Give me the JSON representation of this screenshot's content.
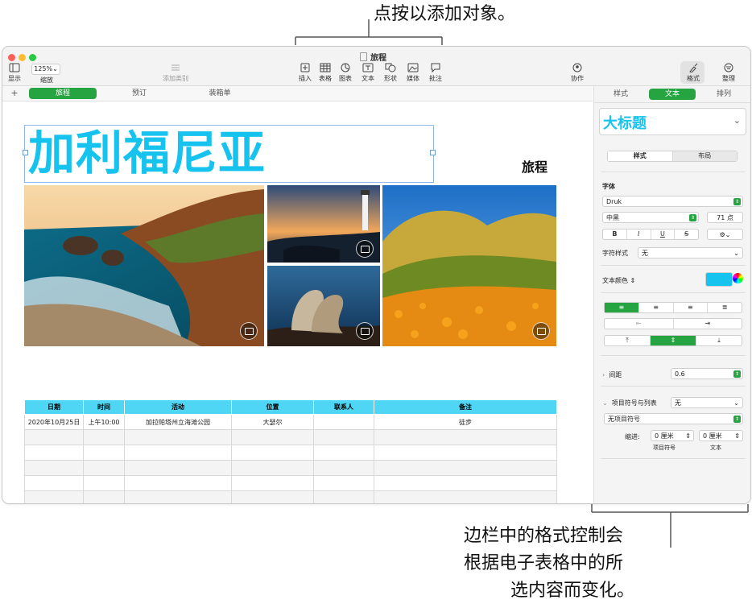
{
  "callouts": {
    "top": "点按以添加对象。",
    "bottom_line1": "边栏中的格式控制会",
    "bottom_line2": "根据电子表格中的所",
    "bottom_line3": "选内容而变化。"
  },
  "window": {
    "title": "旅程"
  },
  "toolbar": {
    "view_label": "显示",
    "zoom_value": "125%",
    "zoom_label": "缩放",
    "add_category_label": "添加类别",
    "insert_label": "插入",
    "table_label": "表格",
    "chart_label": "图表",
    "text_label": "文本",
    "shape_label": "形状",
    "media_label": "媒体",
    "comment_label": "批注",
    "collaborate_label": "协作",
    "format_label": "格式",
    "organize_label": "整理"
  },
  "sheet_tabs": {
    "add": "+",
    "items": [
      "旅程",
      "预订",
      "装箱单"
    ]
  },
  "document": {
    "heading": "加利福尼亚",
    "subheading": "旅程"
  },
  "table": {
    "headers": [
      "日期",
      "时间",
      "活动",
      "位置",
      "联系人",
      "备注"
    ],
    "rows": [
      [
        "2020年10月25日",
        "上午10:00",
        "加拉帕塔州立海滩公园",
        "大瑟尔",
        "",
        "徒步"
      ],
      [
        "",
        "",
        "",
        "",
        "",
        ""
      ],
      [
        "",
        "",
        "",
        "",
        "",
        ""
      ],
      [
        "",
        "",
        "",
        "",
        "",
        ""
      ],
      [
        "",
        "",
        "",
        "",
        "",
        ""
      ],
      [
        "",
        "",
        "",
        "",
        "",
        ""
      ]
    ]
  },
  "sidebar": {
    "tabs": [
      "样式",
      "文本",
      "排列"
    ],
    "paragraph_style": "大标题",
    "style_layout": [
      "样式",
      "布局"
    ],
    "font_section": "字体",
    "font_name": "Druk",
    "font_weight": "中黑",
    "font_size": "71 点",
    "bold": "B",
    "italic": "I",
    "underline": "U",
    "strike": "S",
    "char_style_label": "字符样式",
    "char_style_value": "无",
    "text_color_label": "文本颜色",
    "text_color": "#16c3ef",
    "spacing_label": "间距",
    "spacing_value": "0.6",
    "bullets_label": "项目符号与列表",
    "bullets_value": "无",
    "no_bullets": "无项目符号",
    "indent_label": "缩进:",
    "indent_bullet_value": "0 厘米",
    "indent_text_value": "0 厘米",
    "indent_bullet_caption": "项目符号",
    "indent_text_caption": "文本"
  },
  "colors": {
    "accent_green": "#27a442",
    "heading_cyan": "#16c3ef",
    "table_header": "#4ed6f4"
  }
}
